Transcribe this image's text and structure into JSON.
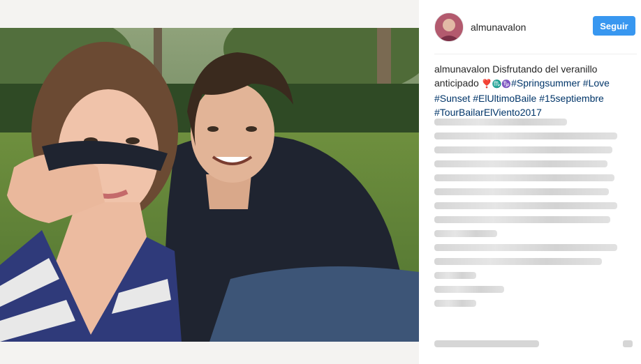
{
  "post": {
    "username": "almunavalon",
    "follow_label": "Seguir",
    "caption_user": "almunavalon",
    "caption_text": " Disfrutando del veranillo anticipado ",
    "caption_emoji": "❣️",
    "caption_symbols": "♏️♑️",
    "hashtags": [
      "#Springsummer",
      "#Love",
      "#Sunset",
      "#ElUltimoBaile",
      "#15septiembre",
      "#TourBailarElViento2017"
    ]
  },
  "colors": {
    "accent": "#3897f0",
    "hashtag": "#003569",
    "text": "#262626"
  },
  "icons": {
    "avatar": "profile-avatar"
  }
}
